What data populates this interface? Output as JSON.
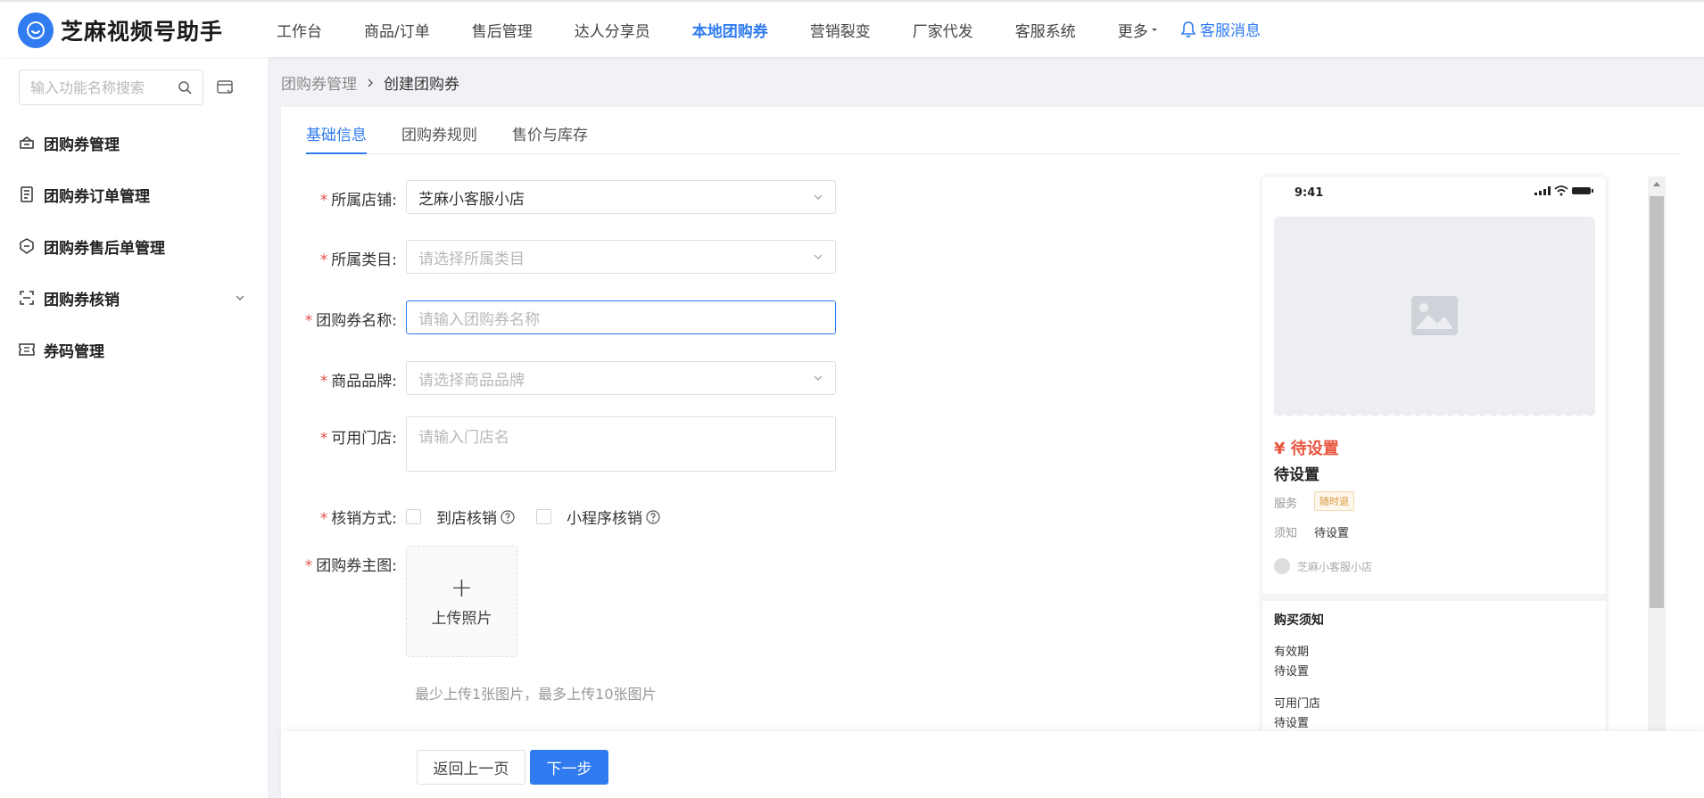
{
  "app": {
    "title": "芝麻视频号助手"
  },
  "nav": {
    "items": [
      "工作台",
      "商品/订单",
      "售后管理",
      "达人分享员",
      "本地团购券",
      "营销裂变",
      "厂家代发",
      "客服系统"
    ],
    "active_index": 4,
    "more": "更多",
    "messages": "客服消息"
  },
  "sidebar": {
    "search_placeholder": "输入功能名称搜索",
    "items": [
      {
        "label": "团购券管理",
        "icon": "coupon-icon"
      },
      {
        "label": "团购券订单管理",
        "icon": "document-icon"
      },
      {
        "label": "团购券售后单管理",
        "icon": "shield-icon"
      },
      {
        "label": "团购券核销",
        "icon": "scan-icon",
        "expandable": true
      },
      {
        "label": "券码管理",
        "icon": "ticket-icon"
      }
    ]
  },
  "breadcrumb": {
    "parent": "团购券管理",
    "current": "创建团购券"
  },
  "tabs": [
    "基础信息",
    "团购券规则",
    "售价与库存"
  ],
  "form": {
    "shop": {
      "label": "所属店铺:",
      "value": "芝麻小客服小店"
    },
    "category": {
      "label": "所属类目:",
      "placeholder": "请选择所属类目"
    },
    "name": {
      "label": "团购券名称:",
      "placeholder": "请输入团购券名称"
    },
    "brand": {
      "label": "商品品牌:",
      "placeholder": "请选择商品品牌"
    },
    "stores": {
      "label": "可用门店:",
      "placeholder": "请输入门店名"
    },
    "verify": {
      "label": "核销方式:",
      "options": [
        "到店核销",
        "小程序核销"
      ]
    },
    "main_image": {
      "label": "团购券主图:",
      "upload_label": "上传照片",
      "plus": "+",
      "hint": "最少上传1张图片，最多上传10张图片"
    }
  },
  "preview": {
    "time": "9:41",
    "price": "¥ 待设置",
    "title": "待设置",
    "service_label": "服务",
    "service_tag": "随时退",
    "notice_label": "须知",
    "notice_value": "待设置",
    "shop_name": "芝麻小客服小店",
    "buy_title": "购买须知",
    "validity_label": "有效期",
    "validity_value": "待设置",
    "stores_label": "可用门店",
    "stores_value": "待设置"
  },
  "footer": {
    "back": "返回上一页",
    "next": "下一步"
  },
  "colors": {
    "primary": "#2f7bef",
    "required": "#e34d4d",
    "price": "#e8553e"
  }
}
